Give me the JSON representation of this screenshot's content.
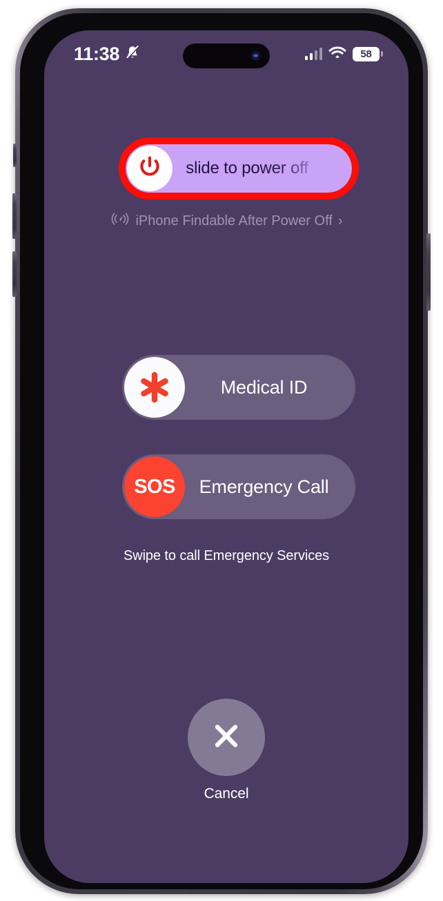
{
  "device": {
    "model_style": "iphone-pro",
    "frame_color": "#413d48",
    "screen_background": "#4c3c63"
  },
  "status_bar": {
    "time": "11:38",
    "silent_icon": "bell-slash-icon",
    "cellular_icon": "cellular-bars-icon",
    "wifi_icon": "wifi-icon",
    "battery_percent": "58",
    "battery_icon": "battery-icon"
  },
  "power_slider": {
    "label": "slide to power off",
    "knob_icon": "power-icon",
    "track_color": "#c9a3f5",
    "knob_color": "#fdfdff",
    "power_glyph_color": "#e01b1b",
    "annotation_color": "#fb0d09",
    "annotated": "true"
  },
  "find_my": {
    "icon": "find-my-broadcast-icon",
    "label": "iPhone Findable After Power Off",
    "chevron": "›"
  },
  "actions": [
    {
      "id": "medical-id",
      "label": "Medical ID",
      "badge_icon": "medical-asterisk-icon",
      "badge_background": "#fbfbfd",
      "badge_foreground": "#f0402c"
    },
    {
      "id": "emergency-call",
      "label": "Emergency Call",
      "badge_icon": "sos-icon",
      "badge_text": "SOS",
      "badge_background": "#fc4230",
      "badge_foreground": "#ffffff"
    }
  ],
  "swipe_hint": "Swipe to call Emergency Services",
  "cancel": {
    "label": "Cancel",
    "icon": "close-x-icon"
  }
}
